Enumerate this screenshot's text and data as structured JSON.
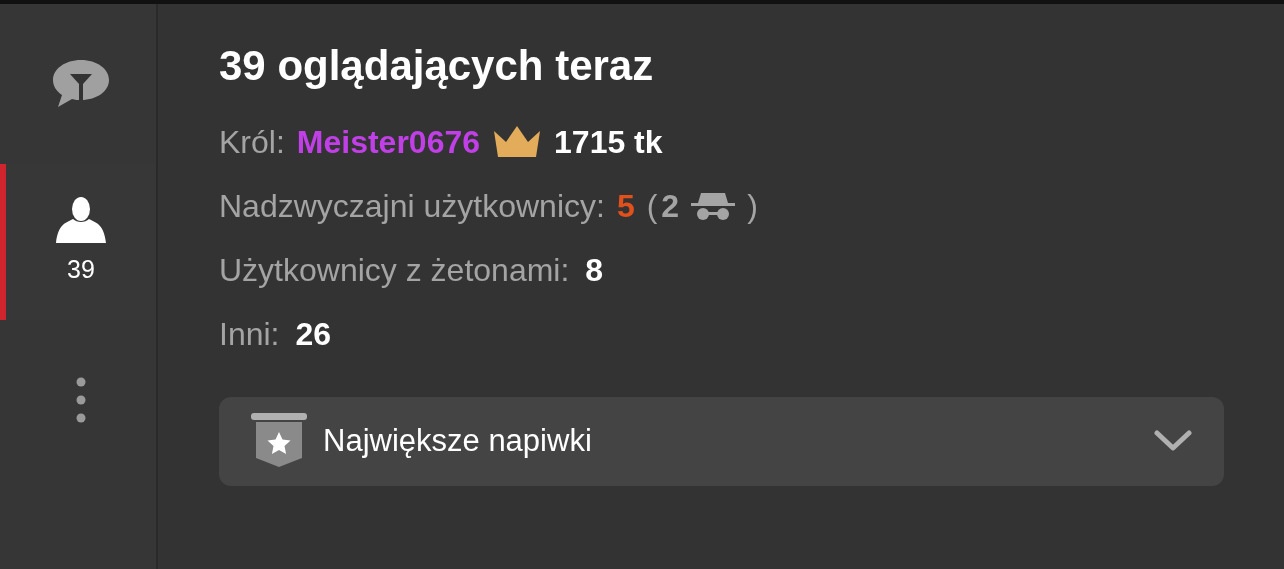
{
  "sidebar": {
    "tabs": [
      {
        "kind": "filter",
        "selected": false
      },
      {
        "kind": "users",
        "selected": true,
        "count": "39"
      },
      {
        "kind": "more",
        "selected": false
      }
    ]
  },
  "viewers": {
    "title": "39 oglądających teraz",
    "king": {
      "label": "Król:",
      "name": "Meister0676",
      "amount": "1715 tk"
    },
    "special": {
      "label": "Nadzwyczajni użytkownicy:",
      "count": "5",
      "open": "(",
      "hidden": "2",
      "close": ")"
    },
    "token_users": {
      "label": "Użytkownicy z żetonami:",
      "value": "8"
    },
    "others": {
      "label": "Inni:",
      "value": "26"
    }
  },
  "top_tips": {
    "label": "Największe napiwki",
    "expanded": false
  }
}
